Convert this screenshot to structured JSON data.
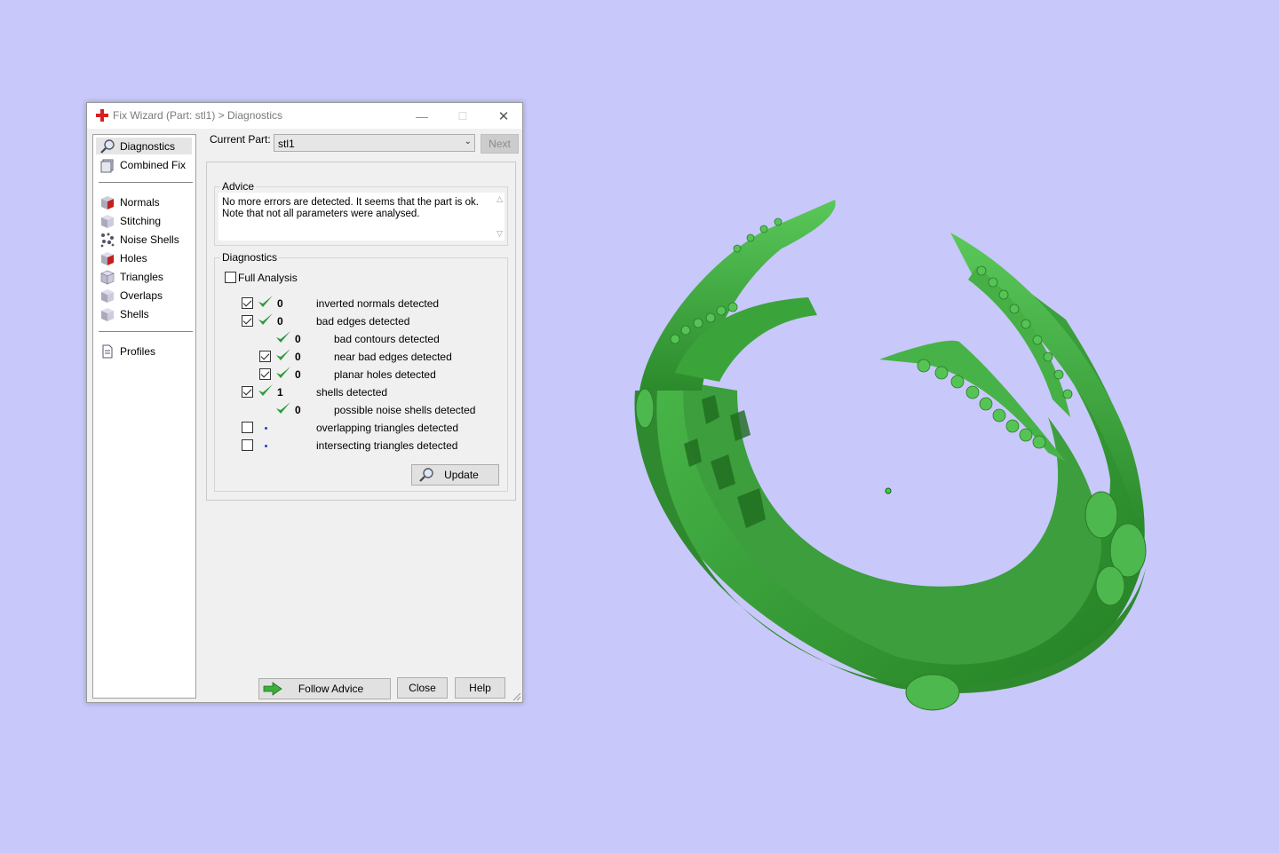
{
  "window": {
    "title": "Fix Wizard (Part: stl1) > Diagnostics",
    "minimize": "—",
    "maximize": "☐",
    "close": "✕"
  },
  "nav": {
    "items": [
      {
        "label": "Diagnostics",
        "icon": "magnifier-icon"
      },
      {
        "label": "Combined Fix",
        "icon": "combined-fix-icon"
      },
      {
        "label": "Normals",
        "icon": "normals-cube-icon"
      },
      {
        "label": "Stitching",
        "icon": "stitching-cube-icon"
      },
      {
        "label": "Noise Shells",
        "icon": "noise-shells-icon"
      },
      {
        "label": "Holes",
        "icon": "holes-cube-icon"
      },
      {
        "label": "Triangles",
        "icon": "triangles-cube-icon"
      },
      {
        "label": "Overlaps",
        "icon": "overlaps-cube-icon"
      },
      {
        "label": "Shells",
        "icon": "shells-cube-icon"
      },
      {
        "label": "Profiles",
        "icon": "document-icon"
      }
    ]
  },
  "current_part": {
    "label": "Current Part:",
    "value": "stl1",
    "next": "Next"
  },
  "advice": {
    "title": "Advice",
    "line1": "No more errors are detected. It seems that the part is ok.",
    "line2": "Note that not all parameters were analysed."
  },
  "diagnostics": {
    "title": "Diagnostics",
    "full_analysis": "Full Analysis",
    "rows": [
      {
        "count": "0",
        "text": "inverted normals detected",
        "checked": true
      },
      {
        "count": "0",
        "text": "bad edges detected",
        "checked": true
      },
      {
        "count": "0",
        "text": "bad contours detected",
        "checked": null
      },
      {
        "count": "0",
        "text": "near bad edges detected",
        "checked": true
      },
      {
        "count": "0",
        "text": "planar holes detected",
        "checked": true
      },
      {
        "count": "1",
        "text": "shells detected",
        "checked": true
      },
      {
        "count": "0",
        "text": "possible noise shells detected",
        "checked": null
      },
      {
        "count": "",
        "text": "overlapping triangles detected",
        "checked": false
      },
      {
        "count": "",
        "text": "intersecting triangles detected",
        "checked": false
      }
    ],
    "update": "Update"
  },
  "footer": {
    "follow_advice": "Follow Advice",
    "close": "Close",
    "help": "Help"
  },
  "colors": {
    "background": "#c8c8fa",
    "model_green": "#3fa03f",
    "check_green": "#2e9a3e"
  }
}
